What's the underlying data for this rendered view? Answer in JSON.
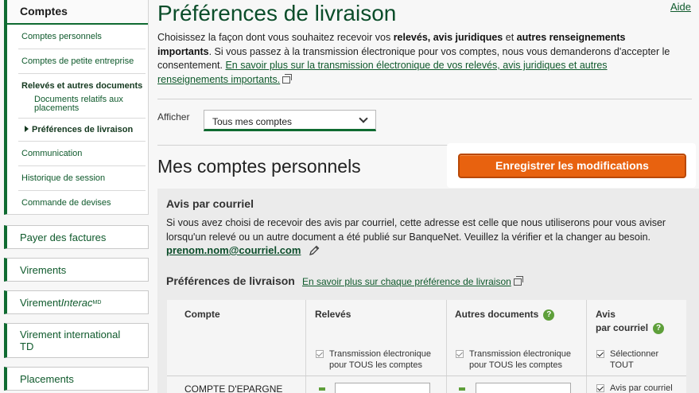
{
  "sidebar": {
    "comptes_header": "Comptes",
    "items": [
      "Comptes personnels",
      "Comptes de petite entreprise",
      "Relevés et autres documents",
      "Documents relatifs aux placements",
      "Préférences de livraison",
      "Communication",
      "Historique de session",
      "Commande de devises"
    ],
    "boxes": {
      "payer": "Payer des factures",
      "virements": "Virements",
      "virement_interac_prefix": "Virement ",
      "virement_interac_brand": "Interac",
      "virement_interac_sup": "MD",
      "virement_international": "Virement international TD",
      "placements": "Placements"
    }
  },
  "header": {
    "aide": "Aide",
    "title": "Préférences de livraison"
  },
  "intro": {
    "p1": "Choisissez la façon dont vous souhaitez recevoir vos ",
    "b1": "relevés, avis juridiques",
    "p2": " et ",
    "b2": "autres renseignements importants",
    "p3": ". Si vous passez à la transmission électronique pour vos comptes, nous vous demanderons d'accepter le consentement. ",
    "link": "En savoir plus sur la transmission électronique de vos relevés, avis juridiques et autres renseignements importants."
  },
  "filter": {
    "label": "Afficher",
    "selected": "Tous mes comptes"
  },
  "section_title": "Mes comptes personnels",
  "save_button": "Enregistrer les modifications",
  "avis": {
    "title": "Avis par courriel",
    "text": "Si vous avez choisi de recevoir des avis par courriel, cette adresse est celle que nous utiliserons pour vous aviser lorsqu'un relevé ou un autre document a été publié sur BanqueNet. Veuillez la vérifier et la changer au besoin.",
    "email": "prenom.nom@courriel.com"
  },
  "preferences": {
    "title": "Préférences de livraison",
    "link": "En savoir plus sur chaque préférence de livraison"
  },
  "table": {
    "col_compte": "Compte",
    "col_releves": "Relevés",
    "col_autres": "Autres documents",
    "col_avis_1": "Avis",
    "col_avis_2": "par courriel",
    "help_glyph": "?",
    "releves_cb": "Transmission électronique pour TOUS les comptes",
    "autres_cb": "Transmission électronique pour TOUS les comptes",
    "avis_cb": "Sélectionner TOUT",
    "row1_compte": "COMPTE D'EPARGNE",
    "row1_avis": "Avis par courriel"
  }
}
